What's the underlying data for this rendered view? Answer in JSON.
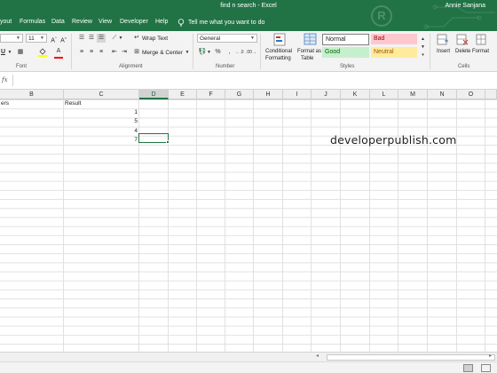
{
  "window": {
    "title": "find n search  -  Excel",
    "user": "Annie Sanjana",
    "logo_letter": "R"
  },
  "tabs": [
    "yout",
    "Formulas",
    "Data",
    "Review",
    "View",
    "Developer",
    "Help"
  ],
  "tell_me": "Tell me what you want to do",
  "ribbon": {
    "font_size": "11",
    "wrap_text": "Wrap Text",
    "merge_center": "Merge & Center",
    "number_format": "General",
    "percent": "%",
    "conditional_formatting_1": "Conditional",
    "conditional_formatting_2": "Formatting",
    "format_as_table_1": "Format as",
    "format_as_table_2": "Table",
    "styles": {
      "normal": "Normal",
      "bad": "Bad",
      "good": "Good",
      "neutral": "Neutral"
    },
    "insert": "Insert",
    "delete": "Delete",
    "format": "Format",
    "groups": {
      "font": "Font",
      "alignment": "Alignment",
      "number": "Number",
      "styles": "Styles",
      "cells": "Cells"
    }
  },
  "formula_bar": {
    "fx": "fx",
    "value": ""
  },
  "columns": [
    "B",
    "C",
    "D",
    "E",
    "F",
    "G",
    "H",
    "I",
    "J",
    "K",
    "L",
    "M",
    "N",
    "O"
  ],
  "cells": {
    "a_header": "ers",
    "c_header": "Result",
    "c_values": [
      "1",
      "5",
      "4",
      "7"
    ]
  },
  "watermark": "developerpublish.com",
  "colors": {
    "excel_green": "#217346",
    "bad_bg": "#ffc7ce",
    "bad_fg": "#9c0006",
    "good_bg": "#c6efce",
    "good_fg": "#006100",
    "neutral_bg": "#ffeb9c",
    "neutral_fg": "#9c5700"
  }
}
